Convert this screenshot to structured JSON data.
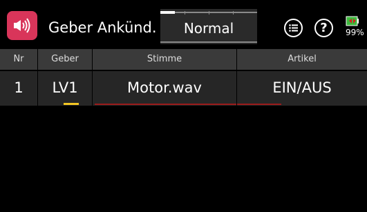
{
  "header": {
    "title": "Geber Ankünd.",
    "mode": "Normal",
    "mode_bar_level": 0.15,
    "menu_icon": "menu-list-icon",
    "help_icon": "help-icon",
    "help_symbol": "?",
    "battery": {
      "percent_label": "99%",
      "level": 0.99,
      "fill_color": "#3db83d"
    },
    "app_icon": "speaker-announcement-icon",
    "app_icon_color": "#d9355a"
  },
  "table": {
    "columns": [
      "Nr",
      "Geber",
      "Stimme",
      "Artikel"
    ],
    "rows": [
      {
        "nr": "1",
        "geber": "LV1",
        "stimme": "Motor.wav",
        "artikel": "EIN/AUS"
      }
    ]
  },
  "colors": {
    "header_bg": "#3a3a3a",
    "row_bg": "#262626",
    "focus_yellow": "#f3c623",
    "accent_red": "#9a1b1b"
  }
}
